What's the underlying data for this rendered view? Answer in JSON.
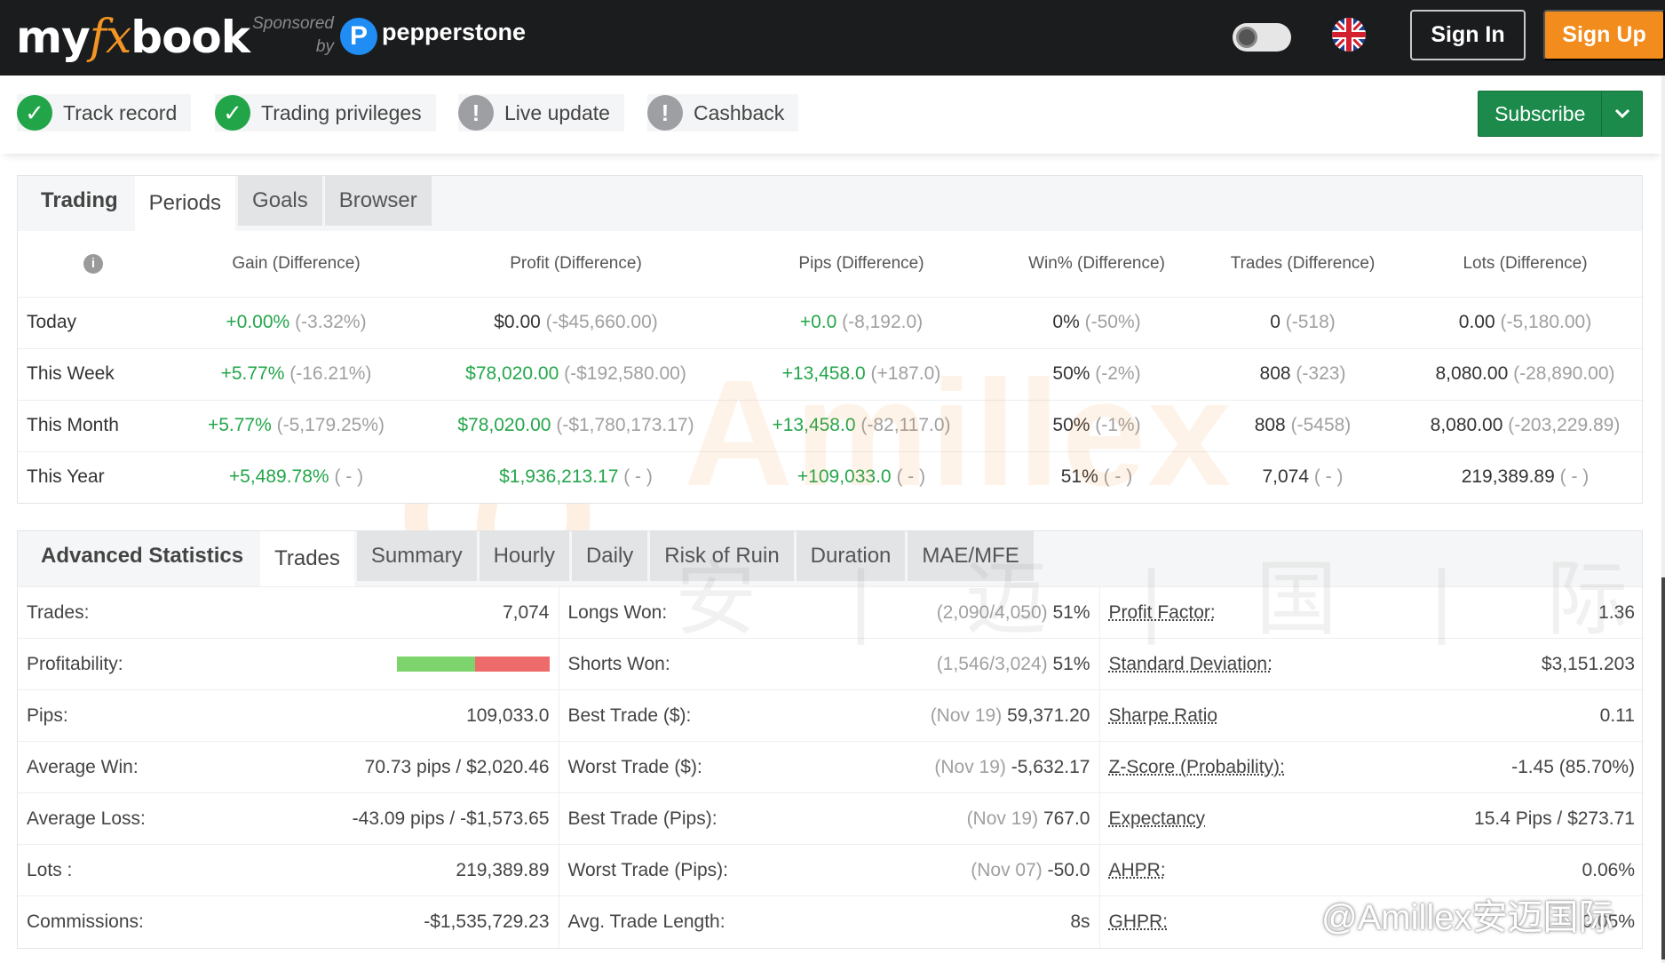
{
  "header": {
    "logo_my": "my",
    "logo_fx": "fx",
    "logo_book": "book",
    "sponsored_line1": "Sponsored",
    "sponsored_line2": "by",
    "sponsor_name": "pepperstone",
    "sponsor_mark": "P",
    "signin_label": "Sign In",
    "signup_label": "Sign Up"
  },
  "status": [
    {
      "label": "Track record",
      "state": "ok"
    },
    {
      "label": "Trading privileges",
      "state": "ok"
    },
    {
      "label": "Live update",
      "state": "warn"
    },
    {
      "label": "Cashback",
      "state": "warn"
    }
  ],
  "subscribe_label": "Subscribe",
  "trading_panel": {
    "tabs": [
      "Trading",
      "Periods",
      "Goals",
      "Browser"
    ],
    "active_tab": "Periods",
    "columns": [
      "Gain (Difference)",
      "Profit (Difference)",
      "Pips (Difference)",
      "Win% (Difference)",
      "Trades (Difference)",
      "Lots (Difference)"
    ],
    "rows": [
      {
        "label": "Today",
        "cells": [
          {
            "main": "+0.00%",
            "diff": "(-3.32%)",
            "main_color": "pos"
          },
          {
            "main": "$0.00",
            "diff": "(-$45,660.00)",
            "main_color": "plain"
          },
          {
            "main": "+0.0",
            "diff": "(-8,192.0)",
            "main_color": "pos"
          },
          {
            "main": "0%",
            "diff": "(-50%)",
            "main_color": "plain"
          },
          {
            "main": "0",
            "diff": "(-518)",
            "main_color": "plain"
          },
          {
            "main": "0.00",
            "diff": "(-5,180.00)",
            "main_color": "plain"
          }
        ]
      },
      {
        "label": "This Week",
        "cells": [
          {
            "main": "+5.77%",
            "diff": "(-16.21%)",
            "main_color": "pos"
          },
          {
            "main": "$78,020.00",
            "diff": "(-$192,580.00)",
            "main_color": "pos"
          },
          {
            "main": "+13,458.0",
            "diff": "(+187.0)",
            "main_color": "pos"
          },
          {
            "main": "50%",
            "diff": "(-2%)",
            "main_color": "plain"
          },
          {
            "main": "808",
            "diff": "(-323)",
            "main_color": "plain"
          },
          {
            "main": "8,080.00",
            "diff": "(-28,890.00)",
            "main_color": "plain"
          }
        ]
      },
      {
        "label": "This Month",
        "cells": [
          {
            "main": "+5.77%",
            "diff": "(-5,179.25%)",
            "main_color": "pos"
          },
          {
            "main": "$78,020.00",
            "diff": "(-$1,780,173.17)",
            "main_color": "pos"
          },
          {
            "main": "+13,458.0",
            "diff": "(-82,117.0)",
            "main_color": "pos"
          },
          {
            "main": "50%",
            "diff": "(-1%)",
            "main_color": "plain"
          },
          {
            "main": "808",
            "diff": "(-5458)",
            "main_color": "plain"
          },
          {
            "main": "8,080.00",
            "diff": "(-203,229.89)",
            "main_color": "plain"
          }
        ]
      },
      {
        "label": "This Year",
        "cells": [
          {
            "main": "+5,489.78%",
            "diff": "( - )",
            "main_color": "pos"
          },
          {
            "main": "$1,936,213.17",
            "diff": "( - )",
            "main_color": "pos"
          },
          {
            "main": "+109,033.0",
            "diff": "( - )",
            "main_color": "pos"
          },
          {
            "main": "51%",
            "diff": "( - )",
            "main_color": "plain"
          },
          {
            "main": "7,074",
            "diff": "( - )",
            "main_color": "plain"
          },
          {
            "main": "219,389.89",
            "diff": "( - )",
            "main_color": "plain"
          }
        ]
      }
    ]
  },
  "advanced_panel": {
    "tabs": [
      "Advanced Statistics",
      "Trades",
      "Summary",
      "Hourly",
      "Daily",
      "Risk of Ruin",
      "Duration",
      "MAE/MFE"
    ],
    "active_tab": "Trades",
    "profitability_win_fraction": 0.51,
    "rows": [
      {
        "l1": "Trades:",
        "v1": "7,074",
        "l2": "Longs Won:",
        "v2_gray": "(2,090/4,050)",
        "v2": "51%",
        "l3": "Profit Factor:",
        "v3": "1.36"
      },
      {
        "l1": "Profitability:",
        "v1": "",
        "l2": "Shorts Won:",
        "v2_gray": "(1,546/3,024)",
        "v2": "51%",
        "l3": "Standard Deviation:",
        "v3": "$3,151.203"
      },
      {
        "l1": "Pips:",
        "v1": "109,033.0",
        "l2": "Best Trade ($):",
        "v2_gray": "(Nov 19)",
        "v2": "59,371.20",
        "l3": "Sharpe Ratio",
        "v3": "0.11"
      },
      {
        "l1": "Average Win:",
        "v1": "70.73 pips / $2,020.46",
        "l2": "Worst Trade ($):",
        "v2_gray": "(Nov 19)",
        "v2": "-5,632.17",
        "l3": "Z-Score (Probability):",
        "v3": "-1.45 (85.70%)"
      },
      {
        "l1": "Average Loss:",
        "v1": "-43.09 pips / -$1,573.65",
        "l2": "Best Trade (Pips):",
        "v2_gray": "(Nov 19)",
        "v2": "767.0",
        "l3": "Expectancy",
        "v3": "15.4 Pips / $273.71"
      },
      {
        "l1": "Lots :",
        "v1": "219,389.89",
        "l2": "Worst Trade (Pips):",
        "v2_gray": "(Nov 07)",
        "v2": "-50.0",
        "l3": "AHPR:",
        "v3": "0.06%"
      },
      {
        "l1": "Commissions:",
        "v1": "-$1,535,729.23",
        "l2": "Avg. Trade Length:",
        "v2_gray": "",
        "v2": "8s",
        "l3": "GHPR:",
        "v3": "0.05%"
      }
    ]
  },
  "watermark": {
    "brand": "Amillex",
    "cn": "安 | 迈 | 国 | 际",
    "credit": "@Amillex安迈国际"
  },
  "colors": {
    "positive": "#23a64a",
    "accent_orange": "#f28c1c",
    "subscribe_green": "#1b8a4b",
    "topbar": "#1b1c1e"
  }
}
